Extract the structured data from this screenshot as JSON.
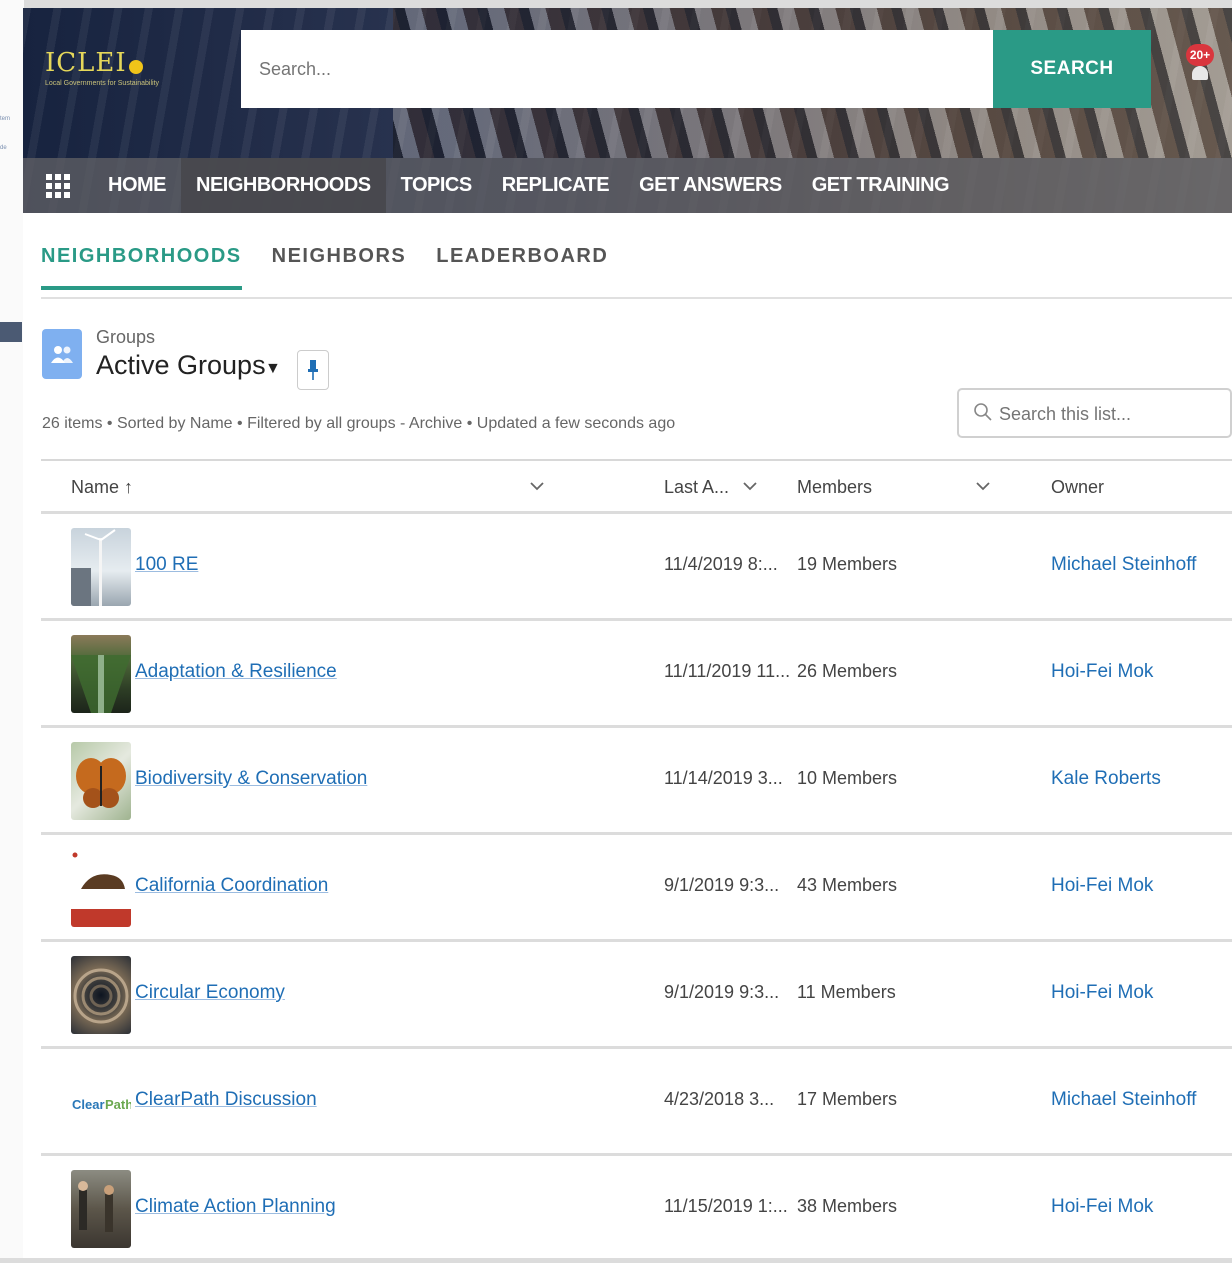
{
  "header": {
    "logo_text": "ICLEI",
    "logo_subtitle": "Local Governments for Sustainability",
    "search_placeholder": "Search...",
    "search_button": "SEARCH",
    "notification_count": "20+"
  },
  "nav": {
    "items": [
      {
        "label": "HOME"
      },
      {
        "label": "NEIGHBORHOODS"
      },
      {
        "label": "TOPICS"
      },
      {
        "label": "REPLICATE"
      },
      {
        "label": "GET ANSWERS"
      },
      {
        "label": "GET TRAINING"
      }
    ],
    "active": "NEIGHBORHOODS"
  },
  "tabs": [
    {
      "label": "NEIGHBORHOODS",
      "active": true
    },
    {
      "label": "NEIGHBORS",
      "active": false
    },
    {
      "label": "LEADERBOARD",
      "active": false
    }
  ],
  "listview": {
    "object_label": "Groups",
    "title": "Active Groups",
    "meta": "26 items • Sorted by Name • Filtered by all groups - Archive • Updated a few seconds ago",
    "search_placeholder": "Search this list..."
  },
  "table": {
    "columns": [
      "Name",
      "Last A...",
      "Members",
      "Owner"
    ],
    "sort_indicator": "↑",
    "rows": [
      {
        "name": "100 RE",
        "last_activity": "11/4/2019 8:...",
        "members": "19 Members",
        "owner": "Michael Steinhoff",
        "thumb": "wind-turbine-image"
      },
      {
        "name": "Adaptation & Resilience",
        "last_activity": "11/11/2019 11...",
        "members": "26 Members",
        "owner": "Hoi-Fei Mok",
        "thumb": "green-roof-image"
      },
      {
        "name": "Biodiversity & Conservation",
        "last_activity": "11/14/2019 3...",
        "members": "10 Members",
        "owner": "Kale Roberts",
        "thumb": "butterfly-image"
      },
      {
        "name": "California Coordination",
        "last_activity": "9/1/2019 9:3...",
        "members": "43 Members",
        "owner": "Hoi-Fei Mok",
        "thumb": "california-flag-image"
      },
      {
        "name": "Circular Economy",
        "last_activity": "9/1/2019 9:3...",
        "members": "11 Members",
        "owner": "Hoi-Fei Mok",
        "thumb": "spiral-staircase-image"
      },
      {
        "name": "ClearPath Discussion",
        "last_activity": "4/23/2018 3...",
        "members": "17 Members",
        "owner": "Michael Steinhoff",
        "thumb": "clearpath-logo"
      },
      {
        "name": "Climate Action Planning",
        "last_activity": "11/15/2019 1:...",
        "members": "38 Members",
        "owner": "Hoi-Fei Mok",
        "thumb": "people-street-image"
      }
    ]
  },
  "left_strip": {
    "fragment_1": "tem",
    "fragment_2": "de"
  },
  "colors": {
    "accent": "#2a9a86",
    "link": "#1f6eb5",
    "badge": "#d9363e",
    "groups_icon": "#7fb0f0"
  }
}
